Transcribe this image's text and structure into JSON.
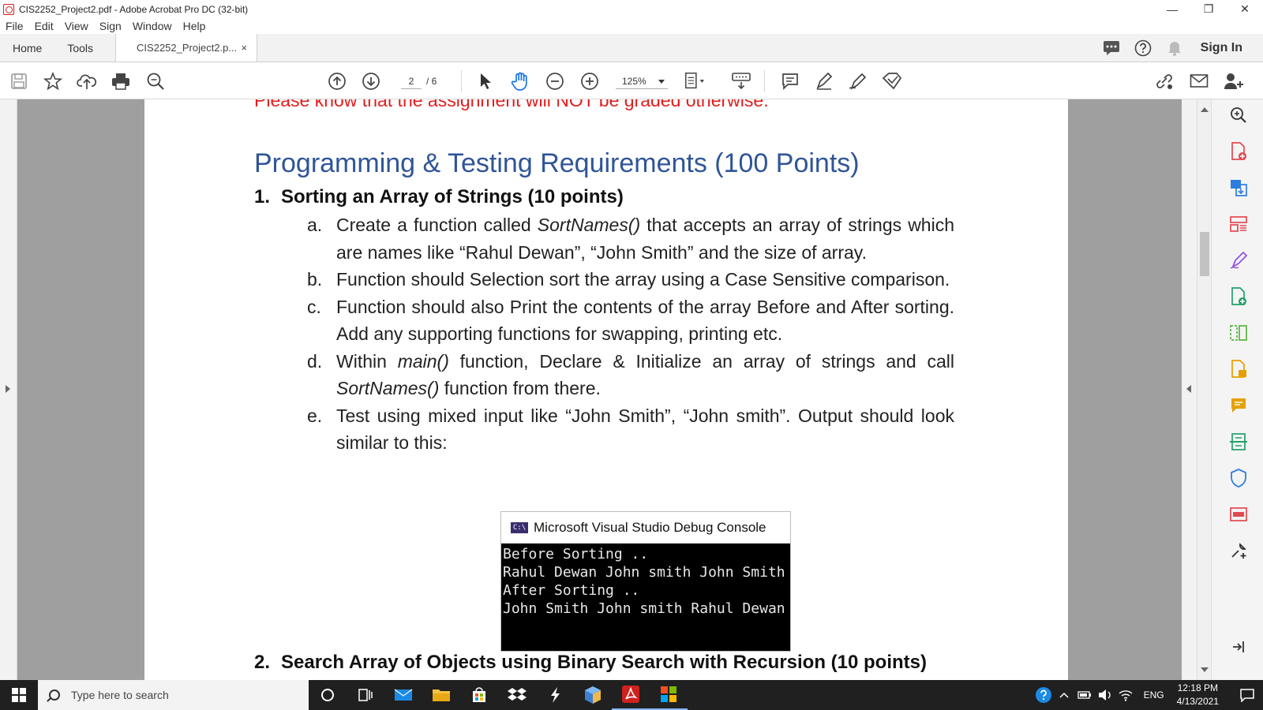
{
  "window": {
    "title": "CIS2252_Project2.pdf - Adobe Acrobat Pro DC (32-bit)",
    "minimize": "—",
    "restore": "❐",
    "close": "✕"
  },
  "menu": [
    "File",
    "Edit",
    "View",
    "Sign",
    "Window",
    "Help"
  ],
  "tabs": {
    "home": "Home",
    "tools": "Tools",
    "doc": "CIS2252_Project2.p...",
    "doc_close": "×",
    "sign_in": "Sign In"
  },
  "toolbar": {
    "current_page": "2",
    "total_pages": "/ 6",
    "zoom": "125%"
  },
  "document": {
    "warning": "Please know that the assignment will NOT be graded otherwise.",
    "heading": "Programming & Testing Requirements (100 Points)",
    "section1_num": "1.",
    "section1_title": "Sorting an Array of Strings (10 points)",
    "items": [
      {
        "label": "a.",
        "pre": "Create a function called ",
        "em": "SortNames()",
        "post": " that accepts an array of strings which are names like “Rahul Dewan”, “John Smith” and the size of array."
      },
      {
        "label": "b.",
        "pre": "Function should Selection sort the array using a Case Sensitive comparison.",
        "em": "",
        "post": ""
      },
      {
        "label": "c.",
        "pre": "Function should also Print the contents of the array Before and After sorting.  Add any supporting functions for swapping, printing etc.",
        "em": "",
        "post": ""
      },
      {
        "label": "d.",
        "pre": "Within ",
        "em": "main()",
        "post": " function, Declare & Initialize an array of strings and call ",
        "em2": "SortNames()",
        "post2": " function from there."
      },
      {
        "label": "e.",
        "pre": "Test using mixed input like “John Smith”, “John smith”.  Output should look similar to this:",
        "em": "",
        "post": ""
      }
    ],
    "console": {
      "icon_text": "C:\\",
      "title": "Microsoft Visual Studio Debug Console",
      "lines": [
        "Before Sorting ..",
        "Rahul Dewan John smith John Smith",
        "",
        "After Sorting ..",
        "John Smith John smith Rahul Dewan"
      ]
    },
    "section2_num": "2.",
    "section2_title": "Search Array of Objects using Binary Search with Recursion (10 points)"
  },
  "taskbar": {
    "search_placeholder": "Type here to search",
    "lang": "ENG",
    "time": "12:18 PM",
    "date": "4/13/2021"
  },
  "colors": {
    "warning": "#e31c1c",
    "heading": "#2f5597",
    "acrobat_red": "#d0211d",
    "taskbar": "#202020"
  }
}
